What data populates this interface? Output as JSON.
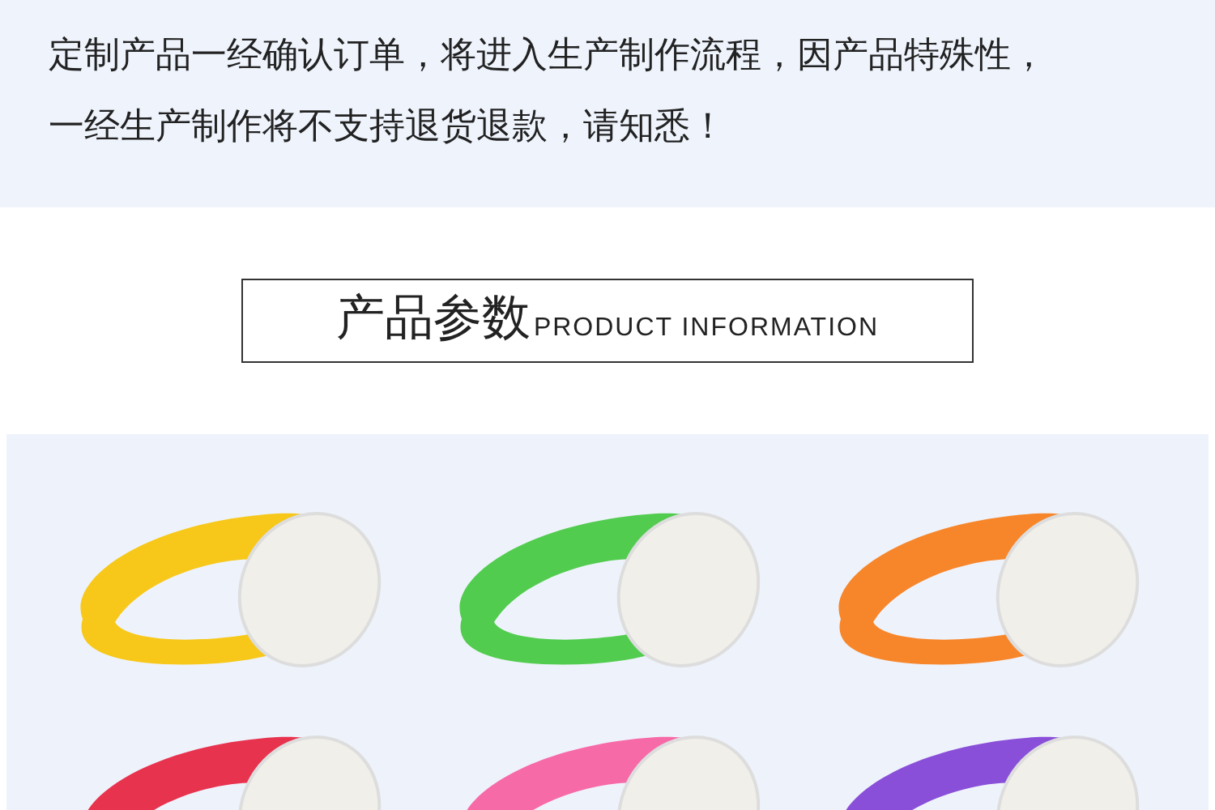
{
  "notice": {
    "lines": [
      "定制产品一经确认订单，将进入生产制作流程，因产品特殊性，",
      "一经生产制作将不支持退货退款，请知悉！"
    ]
  },
  "section_title": {
    "title": "产品参数",
    "subtitle": "PRODUCT INFORMATION"
  },
  "products": [
    {
      "color": "#f7c81a"
    },
    {
      "color": "#52cc4e"
    },
    {
      "color": "#f7862a"
    },
    {
      "color": "#e8334f"
    },
    {
      "color": "#f76aa8"
    },
    {
      "color": "#8a4fd8"
    }
  ]
}
